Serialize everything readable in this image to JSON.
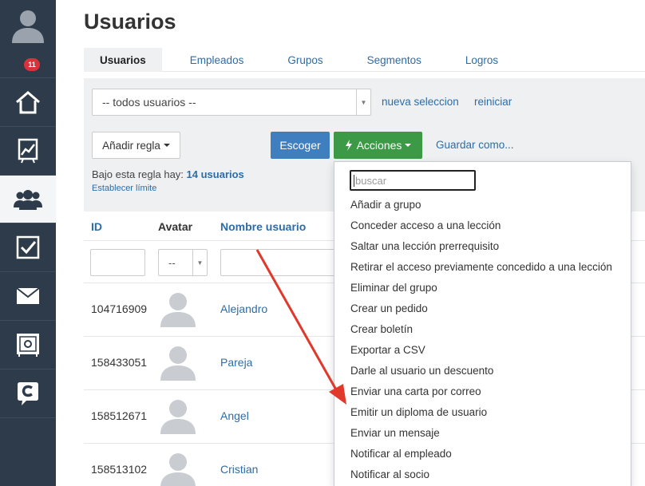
{
  "sidebar": {
    "badge_count": "11",
    "items": [
      {
        "icon": "user-avatar-icon"
      },
      {
        "icon": "home-icon"
      },
      {
        "icon": "chart-icon"
      },
      {
        "icon": "users-icon",
        "active": true
      },
      {
        "icon": "checkbox-icon"
      },
      {
        "icon": "mail-icon"
      },
      {
        "icon": "safe-icon"
      },
      {
        "icon": "chat-c-icon"
      }
    ]
  },
  "page": {
    "title": "Usuarios"
  },
  "tabs": [
    {
      "label": "Usuarios",
      "active": true
    },
    {
      "label": "Empleados"
    },
    {
      "label": "Grupos"
    },
    {
      "label": "Segmentos"
    },
    {
      "label": "Logros"
    }
  ],
  "filters": {
    "selection_value": "-- todos usuarios --",
    "new_selection_link": "nueva seleccion",
    "reset_link": "reiniciar",
    "add_rule_label": "Añadir regla",
    "choose_label": "Escoger",
    "actions_label": "Acciones",
    "save_as_link": "Guardar como...",
    "rule_text_prefix": "Bajo esta regla hay:",
    "rule_count": "14 usuarios",
    "set_limit_link": "Establecer límite"
  },
  "table": {
    "columns": {
      "id": "ID",
      "avatar": "Avatar",
      "username": "Nombre usuario"
    },
    "avatar_filter_value": "--",
    "rows": [
      {
        "id": "104716909",
        "name": "Alejandro"
      },
      {
        "id": "158433051",
        "name": "Pareja"
      },
      {
        "id": "158512671",
        "name": "Angel"
      },
      {
        "id": "158513102",
        "name": "Cristian"
      }
    ]
  },
  "actions_menu": {
    "search_placeholder": "buscar",
    "items": [
      "Añadir a grupo",
      "Conceder acceso a una lección",
      "Saltar una lección prerrequisito",
      "Retirar el acceso previamente concedido a una lección",
      "Eliminar del grupo",
      "Crear un pedido",
      "Crear boletín",
      "Exportar a CSV",
      "Darle al usuario un descuento",
      "Enviar una carta por correo",
      "Emitir un diploma de usuario",
      "Enviar un mensaje",
      "Notificar al empleado",
      "Notificar al socio"
    ]
  },
  "colors": {
    "sidebar_bg": "#2d3b4a",
    "link_blue": "#2d6ca8",
    "choose_button": "#3f7fc0",
    "actions_button": "#3c9a46",
    "badge_red": "#d9323a",
    "annotation_arrow": "#e0392b"
  }
}
